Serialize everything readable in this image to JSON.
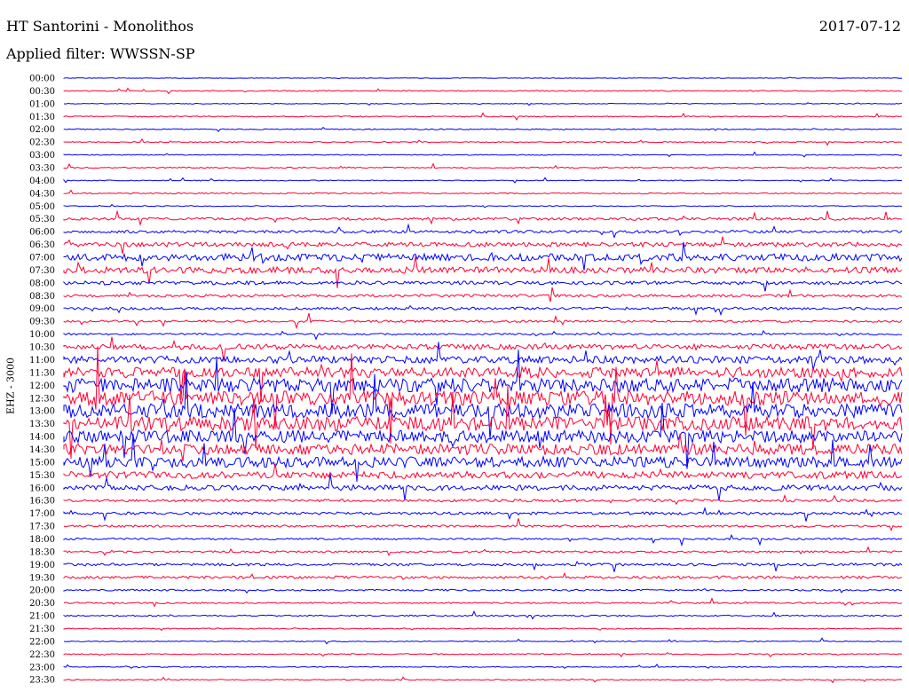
{
  "header": {
    "station": "HT Santorini - Monolithos",
    "date": "2017-07-12",
    "filter": "Applied filter: WWSSN-SP"
  },
  "chart_data": {
    "type": "line",
    "title": "HT Santorini - Monolithos",
    "ylabel": "EHZ - 3000",
    "xlabel": "",
    "trace_colors": [
      "#0000ff",
      "#ff0033"
    ],
    "tick_labels": [
      "00:00",
      "00:30",
      "01:00",
      "01:30",
      "02:00",
      "02:30",
      "03:00",
      "03:30",
      "04:00",
      "04:30",
      "05:00",
      "05:30",
      "06:00",
      "06:30",
      "07:00",
      "07:30",
      "08:00",
      "08:30",
      "09:00",
      "09:30",
      "10:00",
      "10:30",
      "11:00",
      "11:30",
      "12:00",
      "12:30",
      "13:00",
      "13:30",
      "14:00",
      "14:30",
      "15:00",
      "15:30",
      "16:00",
      "16:30",
      "17:00",
      "17:30",
      "18:00",
      "18:30",
      "19:00",
      "19:30",
      "20:00",
      "20:30",
      "21:00",
      "21:30",
      "22:00",
      "22:30",
      "23:00",
      "23:30"
    ],
    "trace_minutes": 30,
    "trace_activity": [
      0.3,
      0.6,
      0.4,
      0.6,
      0.6,
      0.6,
      0.5,
      0.7,
      0.5,
      0.7,
      0.5,
      1.5,
      1.5,
      2.5,
      4,
      3.5,
      2,
      1.5,
      1.5,
      1.2,
      1,
      3,
      4,
      6,
      8,
      8,
      8,
      8,
      7,
      6,
      6,
      4,
      3,
      1.5,
      1.5,
      1.2,
      1,
      1,
      1.5,
      1.5,
      1,
      0.8,
      0.8,
      0.6,
      0.5,
      0.6,
      0.5,
      0.6
    ]
  }
}
